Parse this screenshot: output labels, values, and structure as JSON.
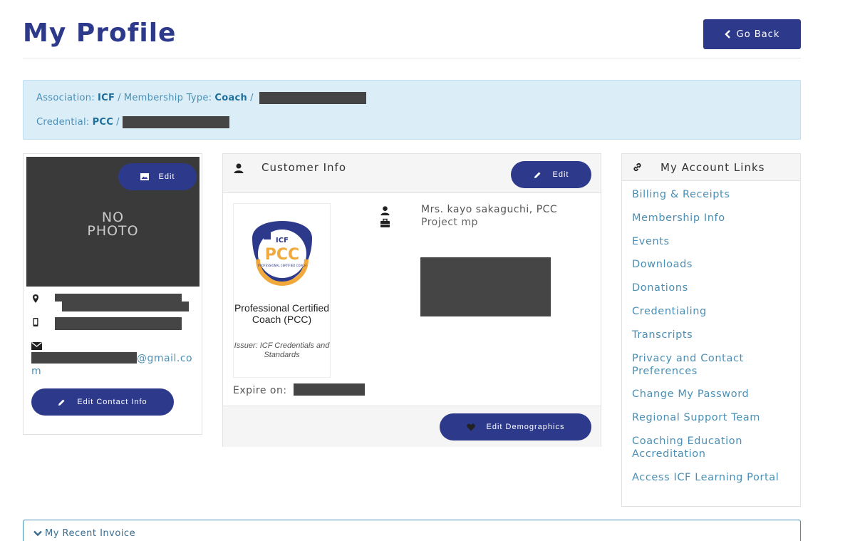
{
  "page": {
    "title": "My Profile",
    "go_back_label": "Go Back"
  },
  "membership": {
    "association_label": "Association:",
    "association_value": "ICF",
    "sep": "/",
    "membership_type_label": "Membership Type:",
    "membership_type_value": "Coach",
    "credential_label": "Credential:",
    "credential_value": "PCC"
  },
  "profile": {
    "no_photo_line1": "NO",
    "no_photo_line2": "PHOTO",
    "photo_edit_label": "Edit",
    "email_suffix": "@gmail.com",
    "edit_contact_label": "Edit Contact Info"
  },
  "customer": {
    "header_title": "Customer Info",
    "edit_label": "Edit",
    "badge_mark_top": "ICF",
    "badge_mark": "PCC",
    "badge_mark_sub": "PROFESSIONAL CERTIFIED COACH",
    "badge_ring_text": "ICF Credentials and Standards",
    "badge_title": "Professional Certified Coach (PCC)",
    "badge_issuer": "Issuer: ICF Credentials and Standards",
    "name": "Mrs. kayo sakaguchi, PCC",
    "project": "Project mp",
    "expire_label": "Expire on:",
    "demographics_label": "Edit Demographics"
  },
  "links": {
    "title": "My Account Links",
    "items": [
      "Billing & Receipts",
      "Membership Info",
      "Events",
      "Downloads",
      "Donations",
      "Credentialing",
      "Transcripts",
      "Privacy and Contact Preferences",
      "Change My Password",
      "Regional Support Team",
      "Coaching Education Accreditation",
      "Access ICF Learning Portal"
    ]
  },
  "invoice": {
    "title": "My Recent Invoice"
  },
  "colors": {
    "brand": "#2d3a8c",
    "link": "#4a8fb5",
    "info_bg": "#dbeef8"
  }
}
